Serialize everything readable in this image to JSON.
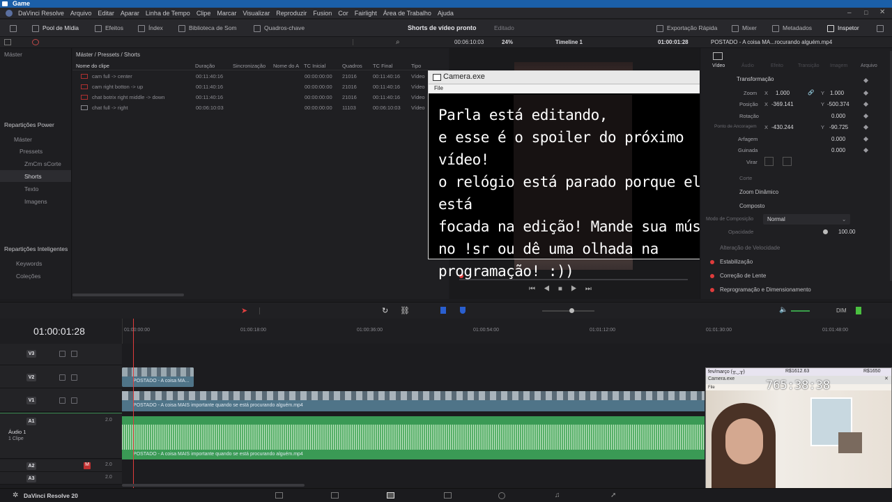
{
  "window": {
    "title": "Game"
  },
  "menu": {
    "items": [
      "DaVinci Resolve",
      "Arquivo",
      "Editar",
      "Aparar",
      "Linha de Tempo",
      "Clipe",
      "Marcar",
      "Visualizar",
      "Reproduzir",
      "Fusion",
      "Cor",
      "Fairlight",
      "Área de Trabalho",
      "Ajuda"
    ]
  },
  "toolbar": {
    "media_pool": "Pool de Mídia",
    "effects": "Efeitos",
    "index": "Índex",
    "sound_library": "Biblioteca de Som",
    "keyframes": "Quadros-chave",
    "project_title": "Shorts de vídeo pronto",
    "project_status": "Editado",
    "quick_export": "Exportação Rápida",
    "mixer": "Mixer",
    "metadata": "Metadados",
    "inspector": "Inspetor"
  },
  "subbar": {
    "zoom": "24%",
    "source_tc": "00:06:10:03",
    "timeline_name": "Timeline 1",
    "timeline_tc": "01:00:01:28",
    "inspector_file": "POSTADO - A coisa MA...rocurando alguém.mp4"
  },
  "sidebar": {
    "master": "Máster",
    "power_bins_title": "Repartições Power",
    "power_bins": [
      "Máster",
      "Pressets",
      "ZmCm sCorte",
      "Shorts",
      "Texto",
      "Imagens"
    ],
    "smart_bins_title": "Repartições Inteligentes",
    "smart_bins": [
      "Keywords",
      "Coleções"
    ]
  },
  "media_pool": {
    "breadcrumb": "Máster / Pressets / Shorts",
    "columns": [
      "Nome do clipe",
      "Duração",
      "Sincronização",
      "Nome do A",
      "TC Inicial",
      "Quadros",
      "TC Final",
      "Tipo"
    ],
    "rows": [
      {
        "name": "cam full -> center",
        "duration": "00:11:40:16",
        "tc_in": "00:00:00:00",
        "frames": "21016",
        "tc_out": "00:11:40:16",
        "type": "Vídeo"
      },
      {
        "name": "cam right botton -> up",
        "duration": "00:11:40:16",
        "tc_in": "00:00:00:00",
        "frames": "21016",
        "tc_out": "00:11:40:16",
        "type": "Vídeo"
      },
      {
        "name": "chat botrix right middle -> down",
        "duration": "00:11:40:16",
        "tc_in": "00:00:00:00",
        "frames": "21016",
        "tc_out": "00:11:40:16",
        "type": "Vídeo"
      },
      {
        "name": "chat full -> right",
        "duration": "00:06:10:03",
        "tc_in": "00:00:00:00",
        "frames": "11103",
        "tc_out": "00:06:10:03",
        "type": "Vídeo"
      }
    ]
  },
  "camera_window": {
    "title": "Camera.exe",
    "file_menu": "File",
    "message": "Parla está editando,\ne esse é o spoiler do próximo vídeo!\no relógio está parado porque ela está\nfocada na edição! Mande sua música\nno !sr ou dê uma olhada na\nprogramação! :))"
  },
  "inspector": {
    "tabs": [
      "Vídeo",
      "Áudio",
      "Efeito",
      "Transição",
      "Imagem",
      "Arquivo"
    ],
    "section_transform": "Transformação",
    "zoom_label": "Zoom",
    "zoom_x": "1.000",
    "zoom_y": "1.000",
    "position_label": "Posição",
    "position_x": "-369.141",
    "position_y": "-500.374",
    "rotation_label": "Rotação",
    "rotation_value": "0.000",
    "anchor_label": "Ponto de Ancoragem",
    "anchor_x": "-430.244",
    "anchor_y": "-90.725",
    "pitch_label": "Arfagem",
    "pitch_value": "0.000",
    "yaw_label": "Guinada",
    "yaw_value": "0.000",
    "flip_label": "Virar",
    "crop_label": "Corte",
    "dynamic_zoom": "Zoom Dinâmico",
    "composite": "Composto",
    "composite_mode_label": "Modo de Composição",
    "composite_mode_value": "Normal",
    "opacity_label": "Opacidade",
    "opacity_value": "100.00",
    "speed_change": "Alteração de Velocidade",
    "stabilization": "Estabilização",
    "lens_correction": "Correção de Lente",
    "reframe": "Reprogramação e Dimensionamento"
  },
  "timeline": {
    "current_tc": "01:00:01:28",
    "ruler": [
      "01:00:00:00",
      "01:00:18:00",
      "01:00:36:00",
      "01:00:54:00",
      "01:01:12:00",
      "01:01:30:00",
      "01:01:48:00"
    ],
    "tracks": [
      {
        "id": "V3"
      },
      {
        "id": "V2"
      },
      {
        "id": "V1"
      },
      {
        "id": "A1",
        "level": "2.0",
        "name": "Áudio 1",
        "clips": "1 Clipe"
      },
      {
        "id": "A2",
        "level": "2.0"
      },
      {
        "id": "A3",
        "level": "2.0"
      }
    ],
    "clip_v2": "POSTADO - A coisa MA...",
    "clip_v1": "POSTADO - A coisa MAIS importante quando se está procurando alguém.mp4",
    "clip_a1": "POSTADO - A coisa MAIS importante quando se está procurando alguém.mp4",
    "dim_label": "DIM"
  },
  "webcam_overlay": {
    "goal": "fev/março (╥‿╥)",
    "amount1": "R$1612.63",
    "amount2": "R$1650",
    "title": "Camera.exe",
    "menu": "File",
    "clock": "765:38:38"
  },
  "footer": {
    "app": "DaVinci Resolve 20"
  },
  "colors": {
    "accent": "#1b5fa8",
    "playhead": "#e03c3c",
    "video_clip": "#5a7f96",
    "audio_clip": "#3a9a55"
  }
}
